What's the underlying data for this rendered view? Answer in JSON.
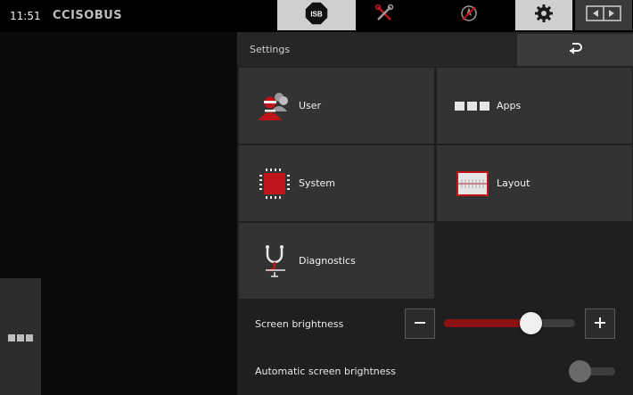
{
  "topbar": {
    "clock": "11:51",
    "brand": "CCISOBUS",
    "isb_label": "ISB"
  },
  "icons": {
    "isb": "isb-octagon-icon",
    "tools": "tools-crossed-icon",
    "navigation": "navigation-disabled-icon",
    "settings": "gear-icon",
    "swap": "swap-screens-icon",
    "back": "return-arrow-icon",
    "apps_menu": "three-squares-icon"
  },
  "settings": {
    "title": "Settings",
    "tiles": [
      {
        "label": "User",
        "icon": "user-group-icon"
      },
      {
        "label": "Apps",
        "icon": "apps-squares-icon"
      },
      {
        "label": "System",
        "icon": "chip-icon"
      },
      {
        "label": "Layout",
        "icon": "layout-screen-icon"
      },
      {
        "label": "Diagnostics",
        "icon": "stethoscope-icon"
      }
    ],
    "brightness": {
      "label": "Screen brightness",
      "level_percent": 66
    },
    "auto_brightness": {
      "label": "Automatic screen brightness",
      "enabled": false
    }
  },
  "colors": {
    "accent_red": "#c0141a",
    "dark_red": "#8a1212",
    "panel_bg": "#1f1f1f",
    "tile_bg": "#333333",
    "active_button": "#cfcfcf"
  }
}
